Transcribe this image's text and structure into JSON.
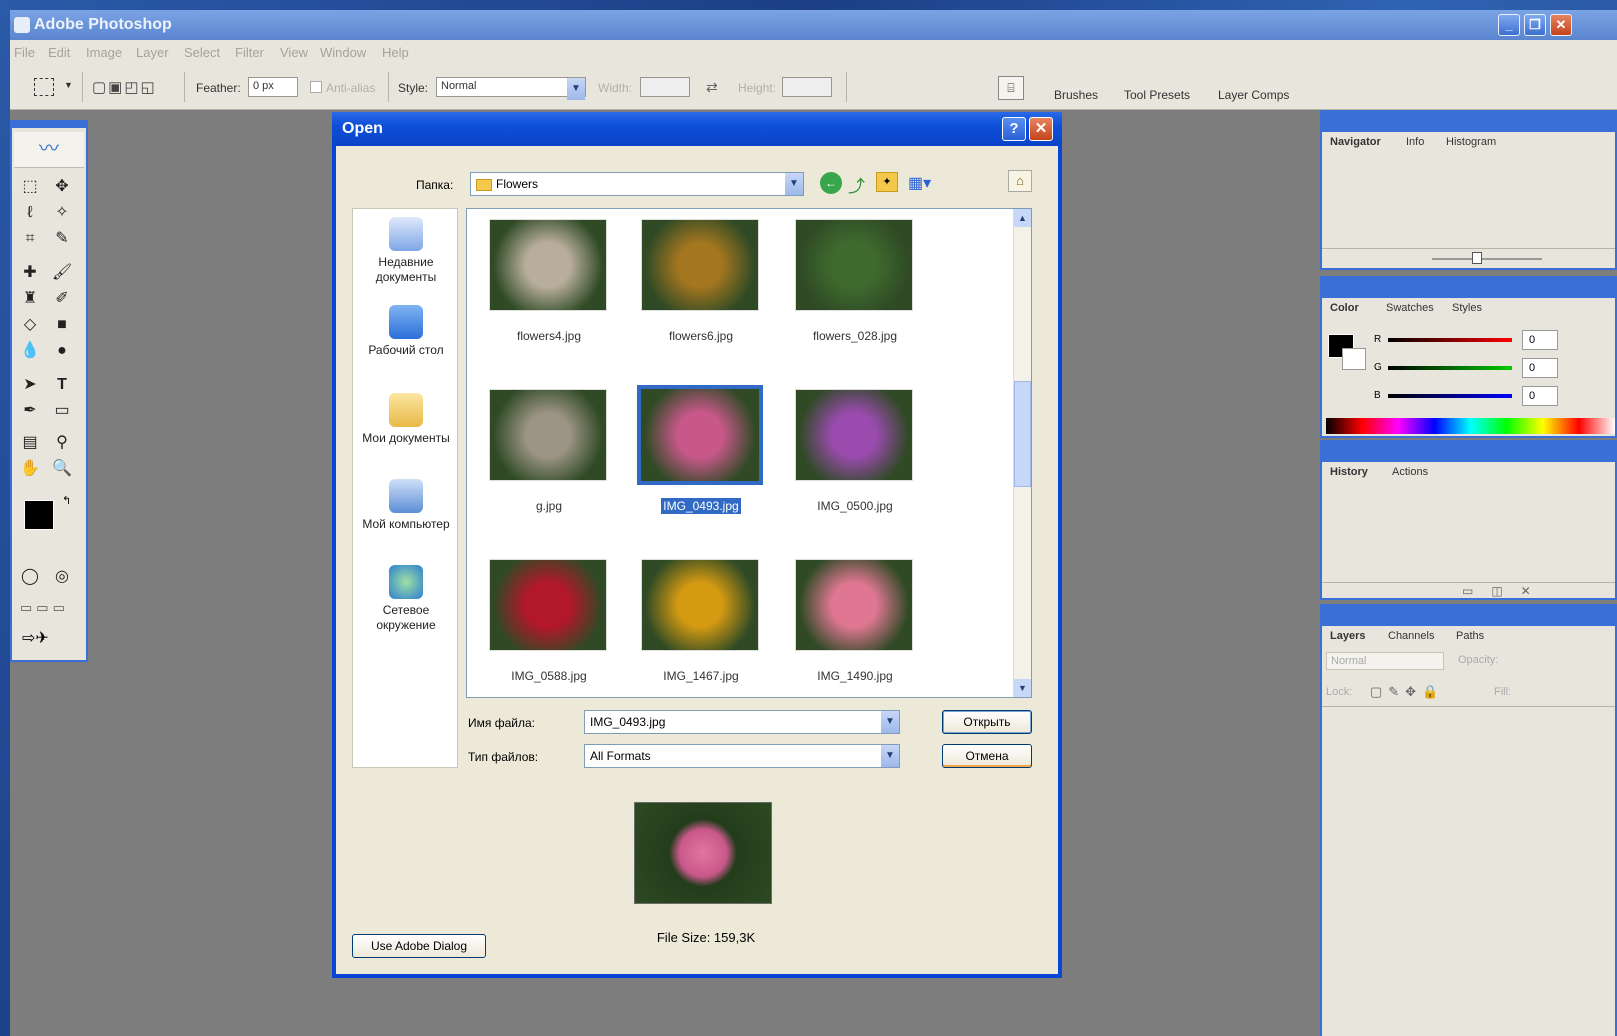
{
  "app": {
    "title": "Adobe Photoshop"
  },
  "menu": [
    "File",
    "Edit",
    "Image",
    "Layer",
    "Select",
    "Filter",
    "View",
    "Window",
    "Help"
  ],
  "options": {
    "feather_label": "Feather:",
    "feather_value": "0 px",
    "antialias_label": "Anti-alias",
    "style_label": "Style:",
    "style_value": "Normal",
    "width_label": "Width:",
    "height_label": "Height:"
  },
  "palette_well": [
    "Brushes",
    "Tool Presets",
    "Layer Comps"
  ],
  "dialog": {
    "title": "Open",
    "folder_label": "Папка:",
    "folder_value": "Flowers",
    "places": [
      "Недавние документы",
      "Рабочий стол",
      "Мои документы",
      "Мой компьютер",
      "Сетевое окружение"
    ],
    "files": [
      {
        "name": "flowers4.jpg",
        "color": "#b9ae9c"
      },
      {
        "name": "flowers6.jpg",
        "color": "#a3761f"
      },
      {
        "name": "flowers_028.jpg",
        "color": "#3f6a2e"
      },
      {
        "name": "g.jpg",
        "color": "#9c9484"
      },
      {
        "name": "IMG_0493.jpg",
        "color": "#c8588a"
      },
      {
        "name": "IMG_0500.jpg",
        "color": "#9a4bae"
      },
      {
        "name": "IMG_0588.jpg",
        "color": "#b3172a"
      },
      {
        "name": "IMG_1467.jpg",
        "color": "#d49a12"
      },
      {
        "name": "IMG_1490.jpg",
        "color": "#e07792"
      }
    ],
    "selected_index": 4,
    "filename_label": "Имя файла:",
    "filename_value": "IMG_0493.jpg",
    "filetype_label": "Тип файлов:",
    "filetype_value": "All Formats",
    "open_button": "Открыть",
    "cancel_button": "Отмена",
    "adobe_dialog_button": "Use Adobe Dialog",
    "file_size": "File Size: 159,3K"
  },
  "panels": {
    "navigator_tabs": [
      "Navigator",
      "Info",
      "Histogram"
    ],
    "color_tabs": [
      "Color",
      "Swatches",
      "Styles"
    ],
    "color_values": {
      "r_label": "R",
      "g_label": "G",
      "b_label": "B",
      "r": "0",
      "g": "0",
      "b": "0"
    },
    "history_tabs": [
      "History",
      "Actions"
    ],
    "layers_tabs": [
      "Layers",
      "Channels",
      "Paths"
    ],
    "layers_mode": "Normal",
    "opacity_label": "Opacity:",
    "lock_label": "Lock:",
    "fill_label": "Fill:"
  }
}
